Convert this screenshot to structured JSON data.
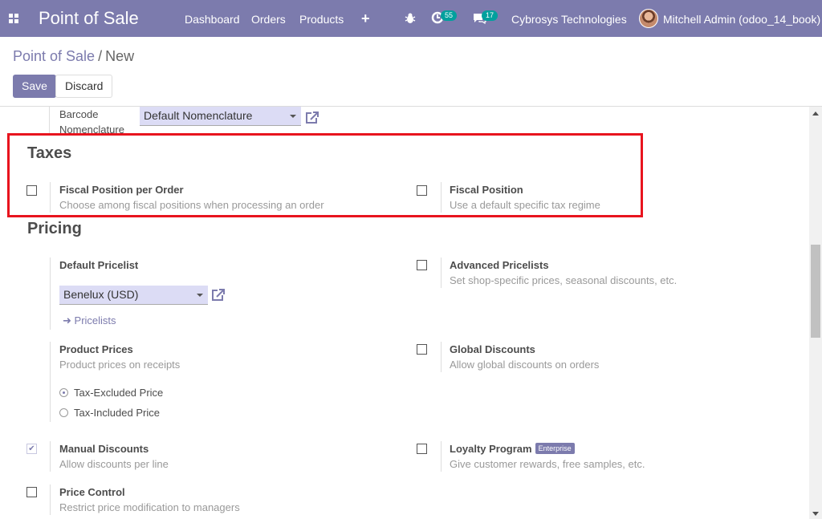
{
  "navbar": {
    "brand": "Point of Sale",
    "menu": [
      "Dashboard",
      "Orders",
      "Products"
    ],
    "plus_icon": "plus-icon",
    "debug_icon": "bug-icon",
    "activity_badge": "55",
    "messages_badge": "17",
    "company": "Cybrosys Technologies",
    "user": "Mitchell Admin (odoo_14_book)",
    "color": "#7c7bad"
  },
  "breadcrumb": {
    "parent": "Point of Sale",
    "separator": "/",
    "current": "New"
  },
  "buttons": {
    "save": "Save",
    "discard": "Discard"
  },
  "barcode": {
    "label_line1": "Barcode",
    "label_line2": "Nomenclature",
    "value": "Default Nomenclature"
  },
  "taxes": {
    "title": "Taxes",
    "fiscal_per_order": {
      "label": "Fiscal Position per Order",
      "desc": "Choose among fiscal positions when processing an order",
      "checked": false
    },
    "fiscal_position": {
      "label": "Fiscal Position",
      "desc": "Use a default specific tax regime",
      "checked": false
    }
  },
  "pricing": {
    "title": "Pricing",
    "default_pricelist": {
      "label": "Default Pricelist",
      "value": "Benelux (USD)",
      "link": "Pricelists"
    },
    "advanced_pricelists": {
      "label": "Advanced Pricelists",
      "desc": "Set shop-specific prices, seasonal discounts, etc.",
      "checked": false
    },
    "product_prices": {
      "label": "Product Prices",
      "desc": "Product prices on receipts",
      "option1": "Tax-Excluded Price",
      "option2": "Tax-Included Price",
      "selected": "Tax-Excluded Price"
    },
    "global_discounts": {
      "label": "Global Discounts",
      "desc": "Allow global discounts on orders",
      "checked": false
    },
    "manual_discounts": {
      "label": "Manual Discounts",
      "desc": "Allow discounts per line",
      "checked": true
    },
    "loyalty_program": {
      "label": "Loyalty Program",
      "badge": "Enterprise",
      "desc": "Give customer rewards, free samples, etc.",
      "checked": false
    },
    "price_control": {
      "label": "Price Control",
      "desc": "Restrict price modification to managers",
      "checked": false
    }
  },
  "highlight_color": "#e8141e"
}
